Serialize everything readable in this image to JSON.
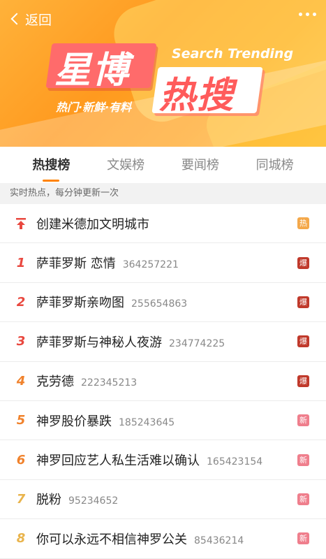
{
  "header": {
    "back_label": "返回",
    "title_line1": "星博",
    "title_line2": "热搜",
    "title_en": "Search Trending",
    "tagline": "热门·新鲜·有料"
  },
  "tabs": [
    {
      "label": "热搜榜",
      "active": true
    },
    {
      "label": "文娱榜",
      "active": false
    },
    {
      "label": "要闻榜",
      "active": false
    },
    {
      "label": "同城榜",
      "active": false
    }
  ],
  "notice": "实时热点，每分钟更新一次",
  "colors": {
    "hot_badge": "#f4a84a",
    "explode_badge": "#c0392b",
    "new_badge": "#ef7e8c",
    "accent": "#ff8200"
  },
  "items": [
    {
      "rank": "",
      "pinned": true,
      "topic": "创建米德加文明城市",
      "count": "",
      "badge": "热",
      "badge_type": "hot"
    },
    {
      "rank": "1",
      "topic": "萨菲罗斯 恋情",
      "count": "364257221",
      "badge": "爆",
      "badge_type": "explode"
    },
    {
      "rank": "2",
      "topic": "萨菲罗斯亲吻图",
      "count": "255654863",
      "badge": "爆",
      "badge_type": "explode"
    },
    {
      "rank": "3",
      "topic": "萨菲罗斯与神秘人夜游",
      "count": "234774225",
      "badge": "爆",
      "badge_type": "explode"
    },
    {
      "rank": "4",
      "topic": "克劳德",
      "count": "222345213",
      "badge": "爆",
      "badge_type": "explode"
    },
    {
      "rank": "5",
      "topic": "神罗股价暴跌",
      "count": "185243645",
      "badge": "新",
      "badge_type": "new"
    },
    {
      "rank": "6",
      "topic": "神罗回应艺人私生活难以确认",
      "count": "165423154",
      "badge": "新",
      "badge_type": "new"
    },
    {
      "rank": "7",
      "topic": "脱粉",
      "count": "95234652",
      "badge": "新",
      "badge_type": "new"
    },
    {
      "rank": "8",
      "topic": "你可以永远不相信神罗公关",
      "count": "85436214",
      "badge": "新",
      "badge_type": "new"
    }
  ]
}
